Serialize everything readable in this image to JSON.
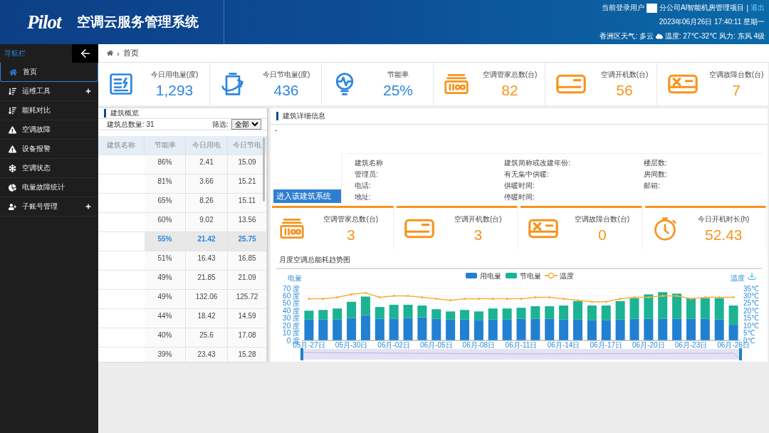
{
  "header": {
    "logo": "Pilot",
    "title": "空调云服务管理系统",
    "user_label": "当前登录用户",
    "user_org": "分公司AI智能机房管理项目",
    "separator": "|",
    "logout": "退出",
    "datetime": "2023年06月26日 17:40:11 星期一",
    "weather": "香洲区天气:  多云",
    "weather_detail": "温度:  27℃-32℃ 风力:  东风 4级"
  },
  "sidebar": {
    "title": "导航栏",
    "items": [
      {
        "label": "首页",
        "selected": true,
        "expandable": false
      },
      {
        "label": "运维工具",
        "selected": false,
        "expandable": true
      },
      {
        "label": "能耗对比",
        "selected": false,
        "expandable": false
      },
      {
        "label": "空调故障",
        "selected": false,
        "expandable": false
      },
      {
        "label": "设备报警",
        "selected": false,
        "expandable": false
      },
      {
        "label": "空调状态",
        "selected": false,
        "expandable": false
      },
      {
        "label": "电量故障统计",
        "selected": false,
        "expandable": false
      },
      {
        "label": "子账号管理",
        "selected": false,
        "expandable": true
      }
    ]
  },
  "breadcrumb": {
    "separator": "›",
    "page": "首页"
  },
  "stats": [
    {
      "label": "今日用电量(度)",
      "value": "1,293",
      "color": "#2e86de"
    },
    {
      "label": "今日节电量(度)",
      "value": "436",
      "color": "#2e86de"
    },
    {
      "label": "节能率",
      "value": "25%",
      "color": "#2e86de"
    },
    {
      "label": "空调管家总数(台)",
      "value": "82",
      "color": "#f7941d"
    },
    {
      "label": "空调开机数(台)",
      "value": "56",
      "color": "#f7941d"
    },
    {
      "label": "空调故障台数(台)",
      "value": "7",
      "color": "#f7941d"
    }
  ],
  "overview": {
    "title": "建筑概览",
    "count_label": "建筑总数量:",
    "count": "31",
    "filter_label": "筛选:",
    "filter_value": "全部",
    "columns": [
      "建筑名称",
      "节能率",
      "今日用电",
      "今日节电"
    ],
    "rows": [
      {
        "rate": "86%",
        "used": "2.41",
        "saved": "15.09",
        "selected": false
      },
      {
        "rate": "81%",
        "used": "3.66",
        "saved": "15.21",
        "selected": false
      },
      {
        "rate": "65%",
        "used": "8.26",
        "saved": "15.11",
        "selected": false
      },
      {
        "rate": "60%",
        "used": "9.02",
        "saved": "13.56",
        "selected": false
      },
      {
        "rate": "55%",
        "used": "21.42",
        "saved": "25.75",
        "selected": true
      },
      {
        "rate": "51%",
        "used": "16.43",
        "saved": "16.85",
        "selected": false
      },
      {
        "rate": "49%",
        "used": "21.85",
        "saved": "21.09",
        "selected": false
      },
      {
        "rate": "49%",
        "used": "132.06",
        "saved": "125.72",
        "selected": false
      },
      {
        "rate": "44%",
        "used": "18.42",
        "saved": "14.59",
        "selected": false
      },
      {
        "rate": "40%",
        "used": "25.6",
        "saved": "17.08",
        "selected": false
      },
      {
        "rate": "39%",
        "used": "23.43",
        "saved": "15.28",
        "selected": false
      }
    ]
  },
  "detail": {
    "title": "建筑详细信息",
    "dash": "-",
    "enter_button": "进入该建筑系统",
    "fields": [
      "建筑名称",
      "建筑简称或改建年份:",
      "楼层数:",
      "管理员:",
      "有无集中供暖:",
      "房间数:",
      "电话:",
      "供暖时间:",
      "邮箱:",
      "地址:",
      "停暖时间:"
    ],
    "stats": [
      {
        "label": "空调管家总数(台)",
        "value": "3"
      },
      {
        "label": "空调开机数(台)",
        "value": "3"
      },
      {
        "label": "空调故障台数(台)",
        "value": "0"
      },
      {
        "label": "今日开机时长(h)",
        "value": "52.43"
      }
    ],
    "chart_title": "月度空调总能耗趋势图",
    "chart_data": {
      "type": "bar",
      "stacked": true,
      "grid": true,
      "legend": "top",
      "ylabel": "电量",
      "y2label": "温度",
      "categories": [
        "05月-27日",
        null,
        null,
        "05月-30日",
        null,
        null,
        "06月-02日",
        null,
        null,
        "06月-05日",
        null,
        null,
        "06月-08日",
        null,
        null,
        "06月-11日",
        null,
        null,
        "06月-14日",
        null,
        null,
        "06月-17日",
        null,
        null,
        "06月-20日",
        null,
        null,
        "06月-23日",
        null,
        null,
        "06月-26日"
      ],
      "series": [
        {
          "name": "用电量",
          "color": "#2280d2",
          "values": [
            28,
            28,
            28,
            30,
            34,
            29,
            29,
            30,
            31,
            29,
            28,
            28,
            27,
            28,
            28,
            29,
            29,
            29,
            28,
            28,
            27,
            27,
            28,
            29,
            29,
            29,
            29,
            29,
            29,
            28,
            21
          ]
        },
        {
          "name": "节电量",
          "color": "#1bb394",
          "values": [
            12,
            13,
            15,
            22,
            25,
            16,
            19,
            18,
            16,
            13,
            11,
            13,
            12,
            15,
            15,
            15,
            17,
            17,
            19,
            25,
            20,
            20,
            25,
            28,
            33,
            36,
            34,
            28,
            28,
            29,
            26
          ]
        },
        {
          "name": "温度",
          "color": "#f5b041",
          "type": "line",
          "axis": "y2",
          "values": [
            28,
            28,
            29,
            31,
            32,
            29,
            30,
            30,
            29,
            28,
            27,
            28,
            28,
            28,
            28,
            28,
            29,
            29,
            28,
            27,
            26,
            26,
            28,
            29,
            29,
            30,
            30,
            28,
            29,
            29,
            29
          ]
        }
      ],
      "ylim": [
        0,
        70
      ],
      "yticks": [
        {
          "value": 0,
          "label": "0 度"
        },
        {
          "value": 10,
          "label": "10 度"
        },
        {
          "value": 20,
          "label": "20 度"
        },
        {
          "value": 30,
          "label": "30 度"
        },
        {
          "value": 40,
          "label": "40 度"
        },
        {
          "value": 50,
          "label": "50 度"
        },
        {
          "value": 60,
          "label": "60 度"
        },
        {
          "value": 70,
          "label": "70 度"
        }
      ],
      "y2lim": [
        0,
        35
      ],
      "y2ticks": [
        {
          "value": 0,
          "label": "0℃"
        },
        {
          "value": 5,
          "label": "5℃"
        },
        {
          "value": 10,
          "label": "10℃"
        },
        {
          "value": 15,
          "label": "15℃"
        },
        {
          "value": 20,
          "label": "20℃"
        },
        {
          "value": 25,
          "label": "25℃"
        },
        {
          "value": 30,
          "label": "30℃"
        },
        {
          "value": 35,
          "label": "35℃"
        }
      ]
    }
  }
}
